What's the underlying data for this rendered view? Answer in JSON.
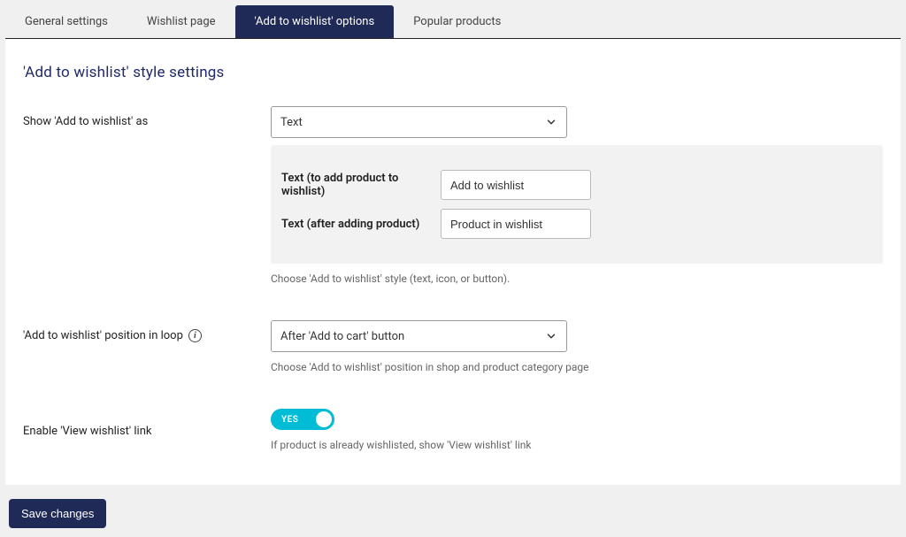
{
  "tabs": {
    "general": "General settings",
    "wishlist_page": "Wishlist page",
    "add_options": "'Add to wishlist' options",
    "popular": "Popular products"
  },
  "section_title": "'Add to wishlist' style settings",
  "show_as": {
    "label": "Show 'Add to wishlist' as",
    "value": "Text",
    "text_add_label": "Text (to add product to wishlist)",
    "text_add_value": "Add to wishlist",
    "text_after_label": "Text (after adding product)",
    "text_after_value": "Product in wishlist",
    "hint": "Choose 'Add to wishlist' style (text, icon, or button)."
  },
  "position": {
    "label": "'Add to wishlist' position in loop",
    "value": "After 'Add to cart' button",
    "hint": "Choose 'Add to wishlist' position in shop and product category page"
  },
  "enable_link": {
    "label": "Enable 'View wishlist' link",
    "toggle_text": "YES",
    "hint": "If product is already wishlisted, show 'View wishlist' link"
  },
  "save": "Save changes"
}
